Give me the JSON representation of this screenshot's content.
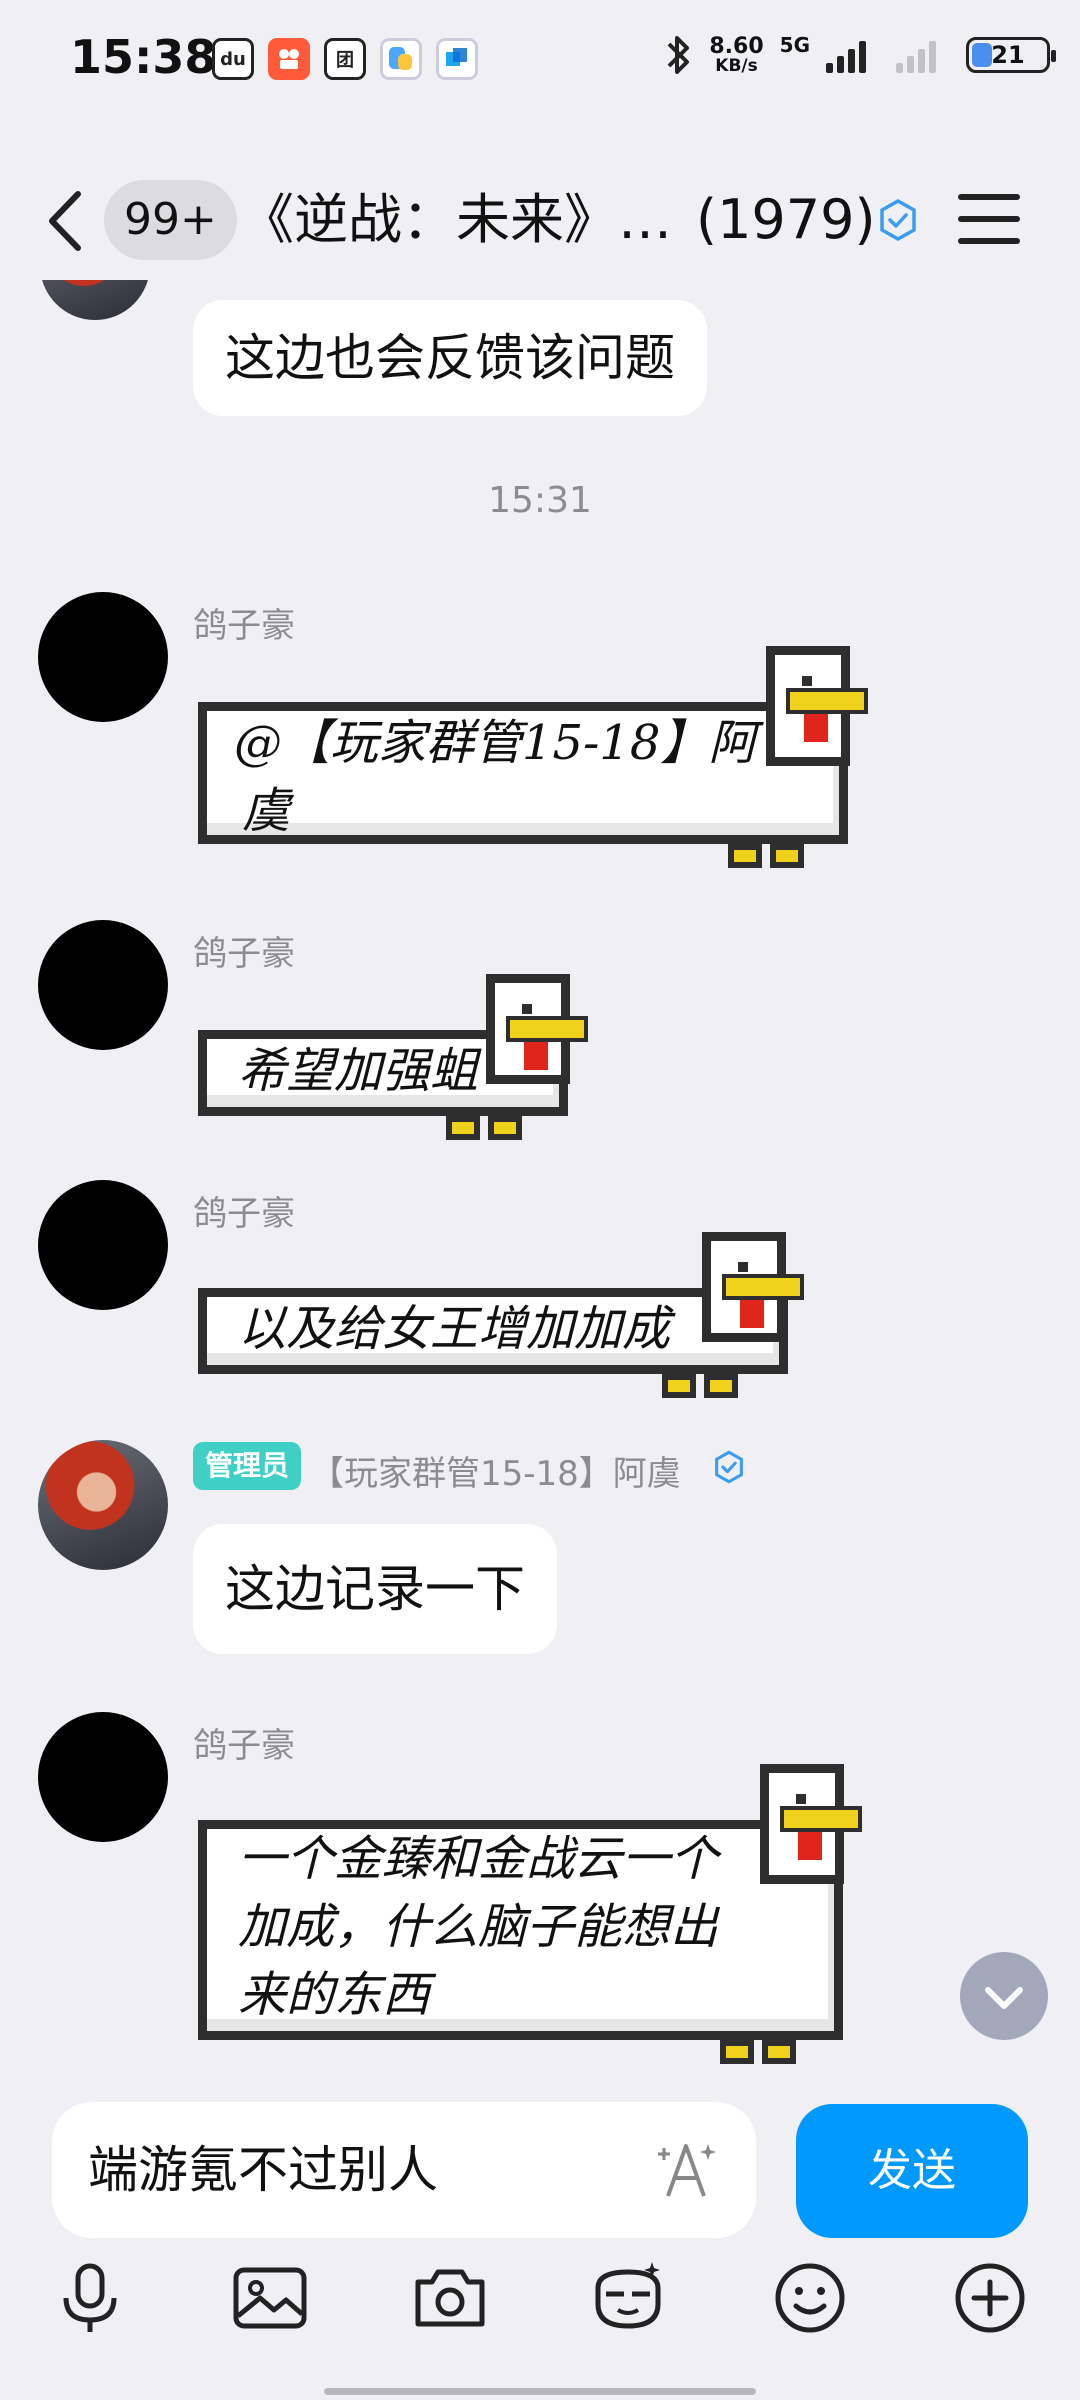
{
  "status_bar": {
    "time": "15:38",
    "app_icons": [
      "dewu-icon",
      "kuaishou-icon",
      "meituan-icon",
      "cloud-app-icon",
      "video-app-icon"
    ],
    "app_icon_letters": [
      "du",
      "",
      "团",
      "",
      ""
    ],
    "network_speed": "8.60",
    "network_unit": "KB/s",
    "network_type": "5G",
    "battery": "21"
  },
  "header": {
    "unread_count": "99+",
    "group_title": "《逆战：未来》…",
    "member_count": "(1979)"
  },
  "messages": [
    {
      "type": "text",
      "text": "这边也会反馈该问题"
    },
    {
      "type": "timestamp",
      "text": "15:31"
    },
    {
      "type": "goose",
      "sender": "鸽子豪",
      "lines": [
        "@【玩家群管15-18】阿",
        "虞"
      ]
    },
    {
      "type": "goose",
      "sender": "鸽子豪",
      "lines": [
        "希望加强蛆"
      ]
    },
    {
      "type": "goose",
      "sender": "鸽子豪",
      "lines": [
        "以及给女王增加加成"
      ]
    },
    {
      "type": "text",
      "admin_tag": "管理员",
      "sender": "【玩家群管15-18】阿虞",
      "text": "这边记录一下"
    },
    {
      "type": "goose",
      "sender": "鸽子豪",
      "lines": [
        "一个金臻和金战云一个",
        "加成，什么脑子能想出",
        "来的东西"
      ]
    }
  ],
  "composer": {
    "draft": "端游氪不过别人",
    "send_label": "发送"
  },
  "toolbar": [
    "microphone-icon",
    "image-icon",
    "camera-icon",
    "sticker-icon",
    "emoji-icon",
    "plus-icon"
  ],
  "colors": {
    "background": "#f0f0f4",
    "accent": "#0099ff",
    "admin_tag": "#3fcfc4",
    "goose_beak": "#f0d21c",
    "goose_wattle": "#e0261c"
  }
}
